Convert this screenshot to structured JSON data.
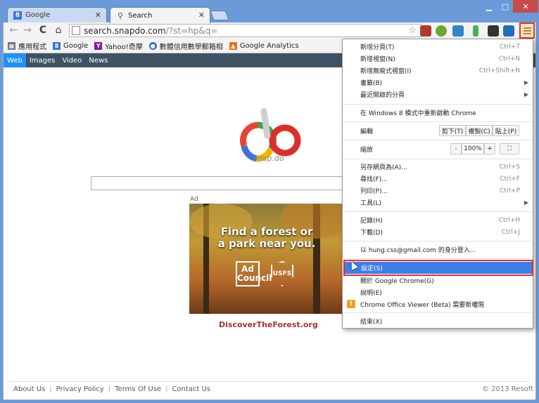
{
  "tabs": [
    {
      "title": "Google",
      "icon": "google-favicon",
      "active": false
    },
    {
      "title": "Search",
      "icon": "search-favicon",
      "active": true
    }
  ],
  "window_controls": {
    "minimize": "▁",
    "maximize": "□",
    "close": "✕"
  },
  "nav": {
    "back": "←",
    "forward": "→",
    "reload": "C",
    "home": "⌂"
  },
  "omnibox": {
    "host": "search.snapdo.com",
    "path": "/?st=hp&q="
  },
  "bookmarks": [
    {
      "label": "應用程式",
      "icon": "apps-icon"
    },
    {
      "label": "Google",
      "icon": "google-icon"
    },
    {
      "label": "Yahoo!奇摩",
      "icon": "yahoo-icon"
    },
    {
      "label": "數體信用數學郵箱相",
      "icon": "globe-icon"
    },
    {
      "label": "Google Analytics",
      "icon": "analytics-icon"
    }
  ],
  "search_nav": [
    "Web",
    "Images",
    "Video",
    "News"
  ],
  "logo_text": "snap.do",
  "ad": {
    "label": "Ad",
    "headline_line1": "Find a forest or",
    "headline_line2": "a park near you.",
    "adcouncil": "Ad Council",
    "usfs": "USFS",
    "url": "DiscoverTheForest.org"
  },
  "footer": {
    "links": [
      "About Us",
      "Privacy Policy",
      "Terms Of Use",
      "Contact Us"
    ],
    "copyright": "© 2013 Resoft"
  },
  "menu": {
    "new_tab": {
      "label": "新增分頁(T)",
      "shortcut": "Ctrl+T"
    },
    "new_window": {
      "label": "新增視窗(N)",
      "shortcut": "Ctrl+N"
    },
    "incognito": {
      "label": "新增無痕式視窗(I)",
      "shortcut": "Ctrl+Shift+N"
    },
    "bookmarks": {
      "label": "書籤(B)"
    },
    "recent_tabs": {
      "label": "最近開啟的分頁"
    },
    "relaunch_win8": {
      "label": "在 Windows 8 模式中重新啟動 Chrome"
    },
    "edit": {
      "label": "編輯",
      "cut": "剪下(T)",
      "copy": "複製(C)",
      "paste": "貼上(P)"
    },
    "zoom": {
      "label": "縮放",
      "minus": "-",
      "value": "100%",
      "plus": "+",
      "fullscreen": "⛶"
    },
    "save_page": {
      "label": "另存網頁為(A)...",
      "shortcut": "Ctrl+S"
    },
    "find": {
      "label": "尋找(F)...",
      "shortcut": "Ctrl+F"
    },
    "print": {
      "label": "列印(P)...",
      "shortcut": "Ctrl+P"
    },
    "tools": {
      "label": "工具(L)"
    },
    "history": {
      "label": "記錄(H)",
      "shortcut": "Ctrl+H"
    },
    "downloads": {
      "label": "下載(D)",
      "shortcut": "Ctrl+J"
    },
    "signin": {
      "label": "以 hung.css@gmail.com 的身分登入..."
    },
    "settings": {
      "label": "設定(S)"
    },
    "about": {
      "label": "關於 Google Chrome(G)"
    },
    "help": {
      "label": "說明(E)"
    },
    "office_viewer": {
      "label": "Chrome Office Viewer (Beta) 需要新權限"
    },
    "exit": {
      "label": "結束(X)"
    }
  },
  "colors": {
    "menu_highlight": "#3b80e6",
    "callout_red": "#e03030",
    "search_nav_bg": "#3e5264"
  }
}
